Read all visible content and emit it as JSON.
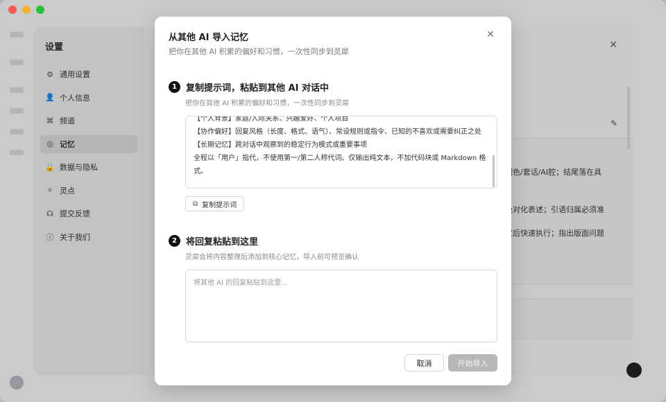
{
  "settings": {
    "title": "设置",
    "items": [
      {
        "label": "通用设置",
        "icon": "gear-icon",
        "glyph": "⚙"
      },
      {
        "label": "个人信息",
        "icon": "user-icon",
        "glyph": "👤"
      },
      {
        "label": "频道",
        "icon": "channel-icon",
        "glyph": "⌘"
      },
      {
        "label": "记忆",
        "icon": "memory-icon",
        "glyph": "◎",
        "active": true
      },
      {
        "label": "数据与隐私",
        "icon": "lock-icon",
        "glyph": "🔒"
      },
      {
        "label": "灵点",
        "icon": "sparkle-icon",
        "glyph": "✧"
      },
      {
        "label": "提交反馈",
        "icon": "feedback-icon",
        "glyph": "☊"
      },
      {
        "label": "关于我们",
        "icon": "info-icon",
        "glyph": "ⓘ"
      }
    ],
    "memory_lines": [
      "泛润色/套话/AI腔；结尾落在具",
      "等绝对化表述；引语归属必须准",
      "向定后快速执行；指出版面问题"
    ]
  },
  "modal": {
    "title": "从其他 AI 导入记忆",
    "subtitle": "把你在其他 AI 积累的偏好和习惯，一次性同步到灵犀",
    "close_glyph": "✕",
    "step1": {
      "num": "1",
      "title": "复制提示词，粘贴到其他 AI 对话中",
      "desc": "把你在其他 AI 积累的偏好和习惯，一次性同步到灵犀",
      "prompt_text": "【个人背景】家庭/人际关系、兴趣爱好、个人项目\n【协作偏好】回复风格（长度、格式、语气）、常设规则或指令、已知的不喜欢或需要纠正之处\n【长期记忆】跨对话中观察到的稳定行为模式或重要事项\n全程以「用户」指代，不使用第一/第二人称代词。仅输出纯文本，不加代码块或 Markdown 格式。",
      "copy_label": "复制提示词",
      "copy_glyph": "⧉"
    },
    "step2": {
      "num": "2",
      "title": "将回复粘贴到这里",
      "desc": "灵犀会将内容整理后添加到核心记忆，导入前可预览确认",
      "placeholder": "将其他 AI 的回复粘贴到这里..."
    },
    "cancel_label": "取消",
    "import_label": "开始导入"
  },
  "colors": {
    "accent_dark": "#111111",
    "import_disabled": "#b7b7b7"
  }
}
